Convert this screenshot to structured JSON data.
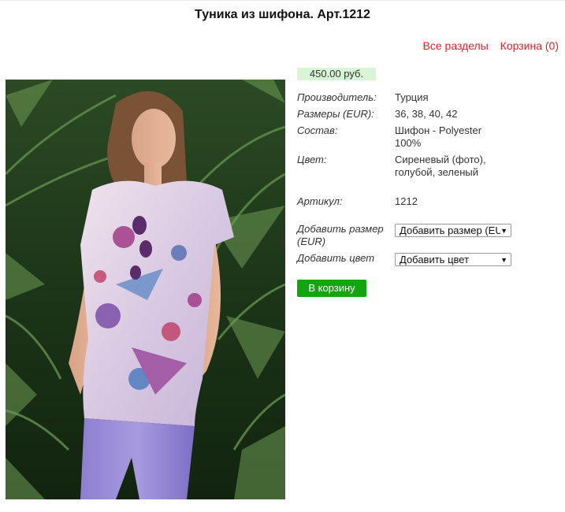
{
  "page": {
    "title": "Туника из шифона. Арт.1212"
  },
  "nav": {
    "all_sections": "Все разделы",
    "cart": "Корзина (0)"
  },
  "product": {
    "price": "450.00 руб.",
    "props": [
      {
        "label": "Производитель:",
        "value": "Турция"
      },
      {
        "label": "Размеры (EUR):",
        "value": "36, 38, 40, 42"
      },
      {
        "label": "Состав:",
        "value": "Шифон - Polyester 100%"
      },
      {
        "label": "Цвет:",
        "value": "Сиреневый (фото), голубой, зеленый"
      },
      {
        "label": "Артикул:",
        "value": "1212"
      }
    ],
    "add_size_label": "Добавить размер (EUR)",
    "add_size_select": "Добавить размер (EUR)",
    "add_color_label": "Добавить цвет",
    "add_color_select": "Добавить цвет",
    "cart_button": "В корзину"
  },
  "colors": {
    "link_red": "#d0282f",
    "price_bg": "#d8f5d6",
    "button_green": "#14a40f"
  }
}
